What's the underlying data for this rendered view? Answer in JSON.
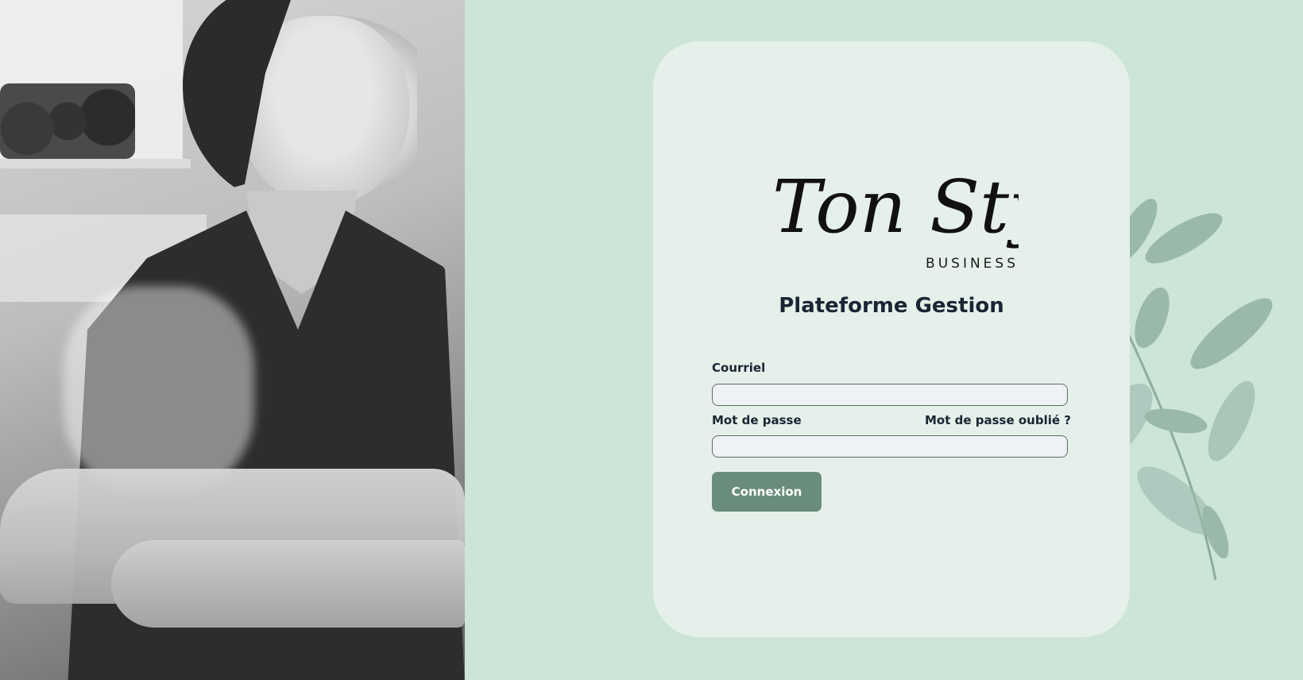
{
  "brand": {
    "logo_script": "Ton Style",
    "logo_sub": "BUSINESS"
  },
  "login": {
    "title": "Plateforme Gestion",
    "email_label": "Courriel",
    "email_value": "",
    "password_label": "Mot de passe",
    "password_value": "",
    "forgot_link": "Mot de passe oublié ?",
    "submit_label": "Connexion"
  },
  "colors": {
    "background": "#cde4d9",
    "card": "#e4f0e9",
    "button": "#6a8c7c",
    "text": "#1b2433",
    "input_bg": "#eef2f5"
  },
  "icons": {
    "decoration": "watercolor-leaves-icon"
  }
}
